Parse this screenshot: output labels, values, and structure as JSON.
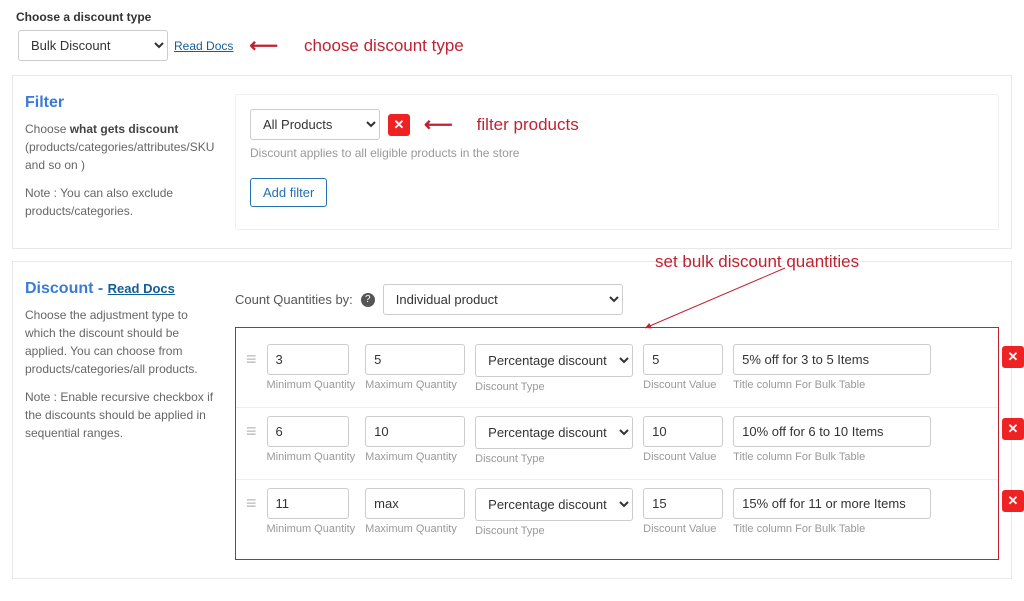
{
  "top": {
    "select_label": "Choose a discount type",
    "selected": "Bulk Discount",
    "docs": "Read Docs",
    "annotation": "choose discount type"
  },
  "filter": {
    "title": "Filter",
    "desc_prefix": "Choose",
    "desc_bold": "what gets discount",
    "desc_suffix": "(products/categories/attributes/SKU and so on )",
    "note": "Note : You can also exclude products/categories.",
    "selected": "All Products",
    "hint": "Discount applies to all eligible products in the store",
    "add_filter": "Add filter",
    "annotation": "filter products"
  },
  "discount": {
    "title": "Discount -",
    "docs": "Read Docs",
    "desc": "Choose the adjustment type to which the discount should be applied. You can choose from products/categories/all products.",
    "note": "Note : Enable recursive checkbox if the discounts should be applied in sequential ranges.",
    "count_label": "Count Quantities by:",
    "count_selected": "Individual product",
    "annotation": "set bulk discount quantities",
    "field_labels": {
      "min": "Minimum Quantity",
      "max": "Maximum Quantity",
      "type": "Discount Type",
      "value": "Discount Value",
      "title": "Title column For Bulk Table"
    },
    "tiers": [
      {
        "min": "3",
        "max": "5",
        "type": "Percentage discount",
        "value": "5",
        "title": "5% off for 3 to 5 Items"
      },
      {
        "min": "6",
        "max": "10",
        "type": "Percentage discount",
        "value": "10",
        "title": "10% off for 6 to 10 Items"
      },
      {
        "min": "11",
        "max": "max",
        "type": "Percentage discount",
        "value": "15",
        "title": "15% off for 11 or more Items"
      }
    ]
  }
}
